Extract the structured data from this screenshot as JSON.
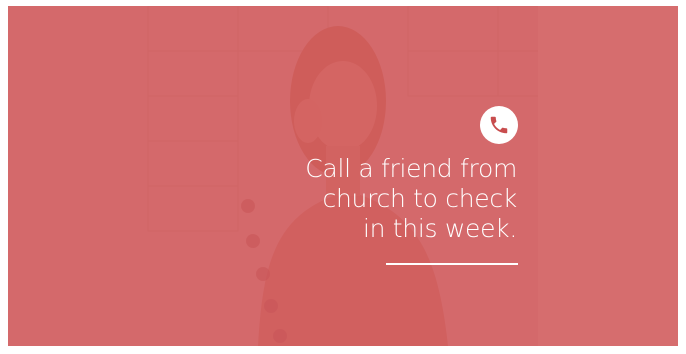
{
  "graphic": {
    "icon": "phone-icon",
    "message_lines": [
      "Call a friend from",
      "church to check",
      "in this week."
    ],
    "colors": {
      "overlay": "#ce4c4e",
      "text": "#ffffff",
      "icon_badge": "#ffffff"
    }
  }
}
